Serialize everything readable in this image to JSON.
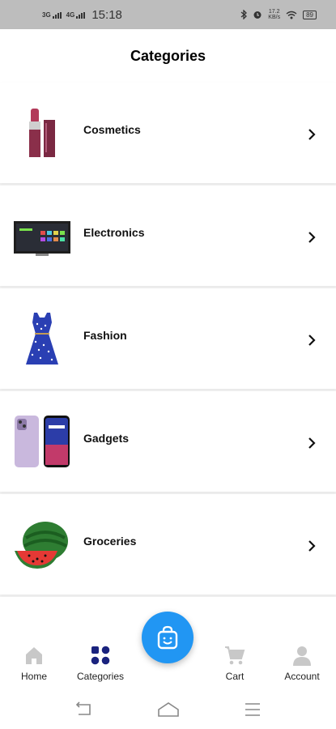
{
  "status_bar": {
    "net1": "3G",
    "net2": "4G",
    "time": "15:18",
    "speed_value": "17.2",
    "speed_unit": "KB/s",
    "battery": "89"
  },
  "header": {
    "title": "Categories"
  },
  "categories": [
    {
      "label": "Cosmetics",
      "icon": "lipstick-icon"
    },
    {
      "label": "Electronics",
      "icon": "tv-icon"
    },
    {
      "label": "Fashion",
      "icon": "dress-icon"
    },
    {
      "label": "Gadgets",
      "icon": "smartphone-icon"
    },
    {
      "label": "Groceries",
      "icon": "watermelon-icon"
    },
    {
      "label": "",
      "icon": "ring-icon"
    }
  ],
  "bottom_nav": {
    "home": "Home",
    "categories": "Categories",
    "cart": "Cart",
    "account": "Account"
  },
  "colors": {
    "accent": "#2196f3",
    "active_nav": "#1a237e",
    "inactive_nav": "#c8c8c8"
  }
}
